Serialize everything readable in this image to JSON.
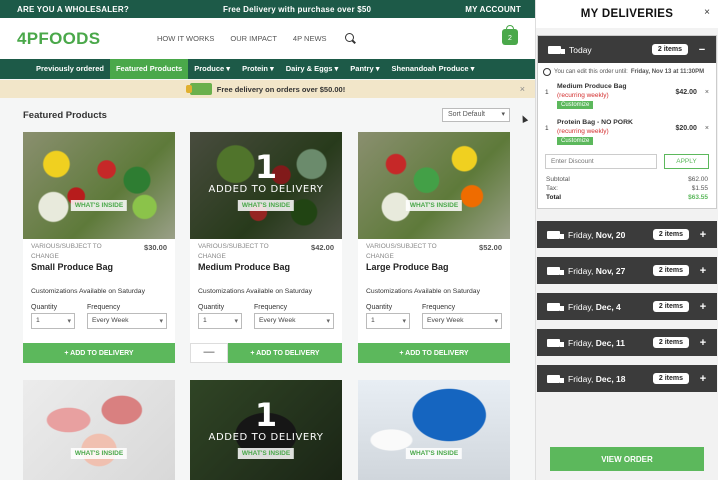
{
  "topbar": {
    "wholesaler": "ARE YOU A WHOLESALER?",
    "promo": "Free Delivery with purchase over $50",
    "account": "MY ACCOUNT"
  },
  "header": {
    "logo": "4PFOODS",
    "nav": [
      "HOW IT WORKS",
      "OUR IMPACT",
      "4P NEWS"
    ],
    "cart_count": "2"
  },
  "categories": [
    "Previously ordered",
    "Featured Products",
    "Produce ▾",
    "Protein ▾",
    "Dairy & Eggs ▾",
    "Pantry ▾",
    "Shenandoah Produce ▾"
  ],
  "banner": {
    "text": "Free delivery on orders over $50.00!",
    "close": "×"
  },
  "section": {
    "title": "Featured Products",
    "sort": "Sort Default"
  },
  "products": [
    {
      "sub": "VARIOUS/SUBJECT TO CHANGE",
      "price": "$30.00",
      "name": "Small Produce Bag",
      "customize": "Customizations Available on Saturday",
      "qty_label": "Quantity",
      "qty": "1",
      "freq_label": "Frequency",
      "freq": "Every Week",
      "add": "+ ADD TO DELIVERY",
      "whats": "WHAT'S INSIDE"
    },
    {
      "sub": "VARIOUS/SUBJECT TO CHANGE",
      "price": "$42.00",
      "name": "Medium Produce Bag",
      "customize": "Customizations Available on Saturday",
      "qty_label": "Quantity",
      "qty": "1",
      "freq_label": "Frequency",
      "freq": "Every Week",
      "add": "+ ADD TO DELIVERY",
      "whats": "WHAT'S INSIDE",
      "added_num": "1",
      "added_text": "ADDED TO DELIVERY",
      "minus": "—"
    },
    {
      "sub": "VARIOUS/SUBJECT TO CHANGE",
      "price": "$52.00",
      "name": "Large Produce Bag",
      "customize": "Customizations Available on Saturday",
      "qty_label": "Quantity",
      "qty": "1",
      "freq_label": "Frequency",
      "freq": "Every Week",
      "add": "+ ADD TO DELIVERY",
      "whats": "WHAT'S INSIDE"
    }
  ],
  "products_row2": [
    {
      "whats": "WHAT'S INSIDE"
    },
    {
      "whats": "WHAT'S INSIDE",
      "added_num": "1",
      "added_text": "ADDED TO DELIVERY"
    },
    {
      "whats": "WHAT'S INSIDE"
    }
  ],
  "sidebar": {
    "title": "MY DELIVERIES",
    "close": "×",
    "today": {
      "label": "Today",
      "count": "2 items",
      "toggle": "−",
      "edit_note_prefix": "You can edit this order until:",
      "edit_note_date": "Friday, Nov 13 at 11:30PM"
    },
    "items": [
      {
        "qty": "1",
        "name": "Medium Produce Bag",
        "recurring": "(recurring weekly)",
        "customize": "Customize",
        "price": "$42.00",
        "remove": "×"
      },
      {
        "qty": "1",
        "name": "Protein Bag - NO PORK",
        "recurring": "(recurring weekly)",
        "customize": "Customize",
        "price": "$20.00",
        "remove": "×"
      }
    ],
    "discount": {
      "placeholder": "Enter Discount",
      "apply": "APPLY"
    },
    "totals": {
      "subtotal_label": "Subtotal",
      "subtotal": "$62.00",
      "tax_label": "Tax:",
      "tax": "$1.55",
      "total_label": "Total",
      "total": "$63.55"
    },
    "deliveries": [
      {
        "day": "Friday,",
        "date": "Nov, 20",
        "count": "2 items",
        "toggle": "+"
      },
      {
        "day": "Friday,",
        "date": "Nov, 27",
        "count": "2 items",
        "toggle": "+"
      },
      {
        "day": "Friday,",
        "date": "Dec, 4",
        "count": "2 items",
        "toggle": "+"
      },
      {
        "day": "Friday,",
        "date": "Dec, 11",
        "count": "2 items",
        "toggle": "+"
      },
      {
        "day": "Friday,",
        "date": "Dec, 18",
        "count": "2 items",
        "toggle": "+"
      }
    ],
    "view_order": "VIEW ORDER"
  },
  "colors": {
    "dark_green": "#1d5a48",
    "green": "#5cb85c",
    "logo_green": "#4aa84a",
    "sidebar_dark": "#3b3b3b",
    "banner": "#f2e6c9"
  }
}
